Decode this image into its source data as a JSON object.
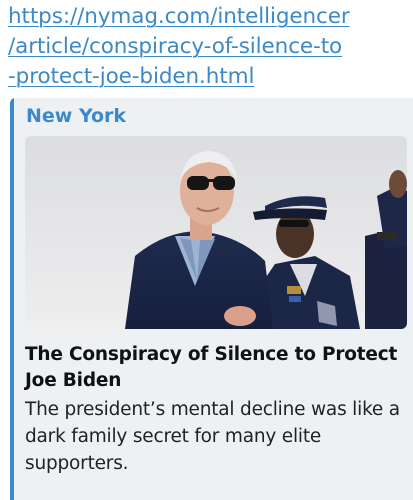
{
  "message": {
    "url_lines": [
      "https://nymag.com/intelligencer",
      "/article/conspiracy-of-silence-to",
      "-protect-joe-biden.html"
    ]
  },
  "link_preview": {
    "site_name": "New York",
    "title": "The Conspiracy of Silence to Protect Joe Biden",
    "description": "The president’s mental decline was like a dark family secret for many elite supporters."
  },
  "colors": {
    "link": "#3b89c9",
    "card_background": "#eef1f3",
    "accent_bar": "#3b89c9"
  }
}
